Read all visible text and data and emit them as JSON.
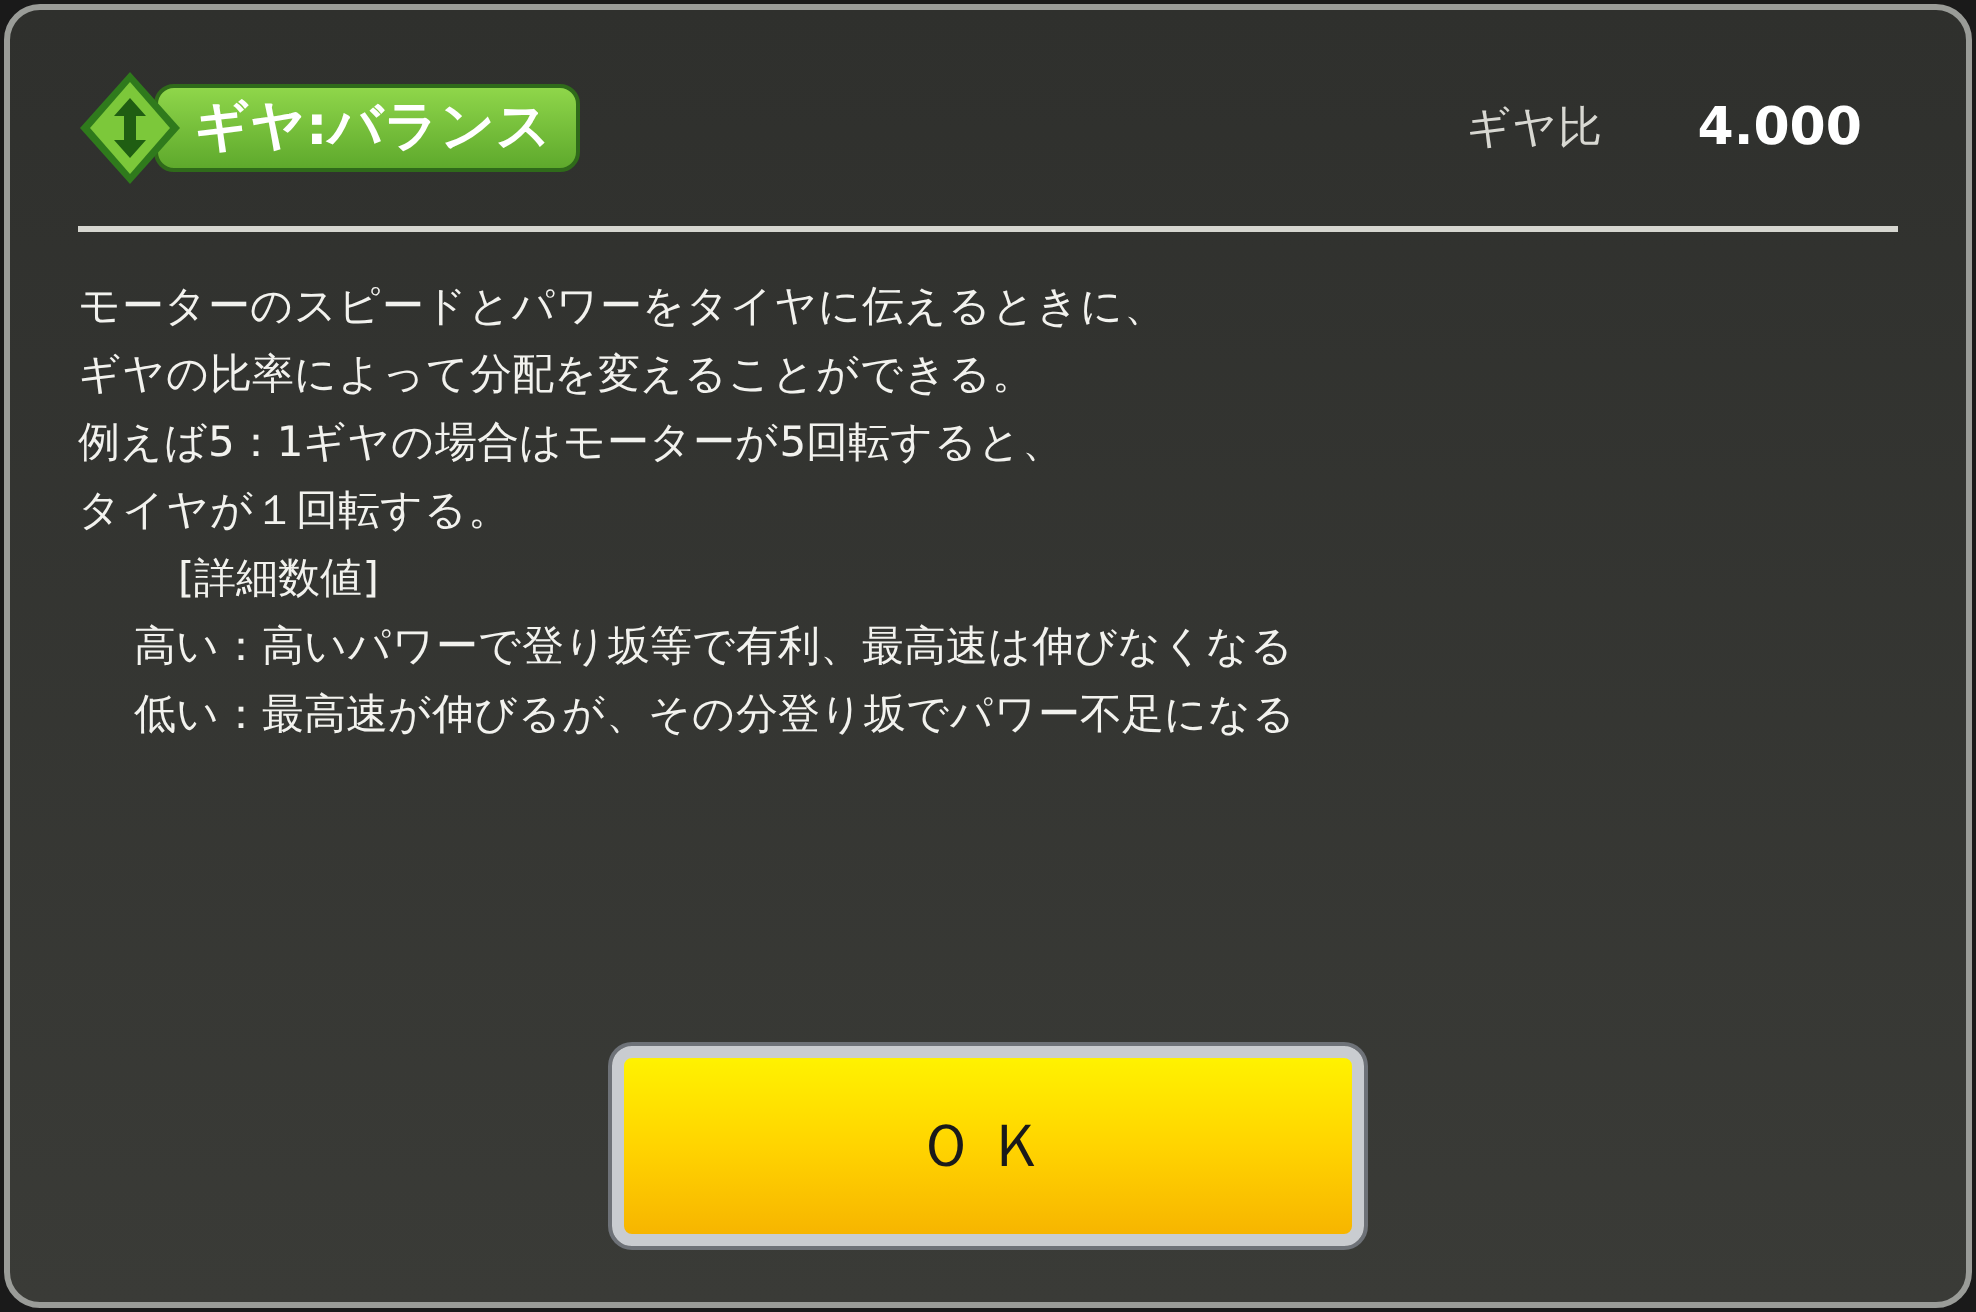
{
  "dialog": {
    "title": "ギヤ:バランス",
    "ratio_label": "ギヤ比",
    "ratio_value": "4.000",
    "lines": [
      {
        "kind": "text",
        "text": "モーターのスピードとパワーをタイヤに伝えるときに、"
      },
      {
        "kind": "text",
        "text": "ギヤの比率によって分配を変えることができる。"
      },
      {
        "kind": "text",
        "text": "例えば5：1ギヤの場合はモーターが5回転すると、"
      },
      {
        "kind": "text",
        "text": "タイヤが１回転する。"
      },
      {
        "kind": "heading",
        "text": "[詳細数値]"
      },
      {
        "kind": "detail",
        "text": "高い：高いパワーで登り坂等で有利、最高速は伸びなくなる"
      },
      {
        "kind": "detail",
        "text": "低い：最高速が伸びるが、その分登り坂でパワー不足になる"
      }
    ],
    "button": "ＯＫ"
  }
}
